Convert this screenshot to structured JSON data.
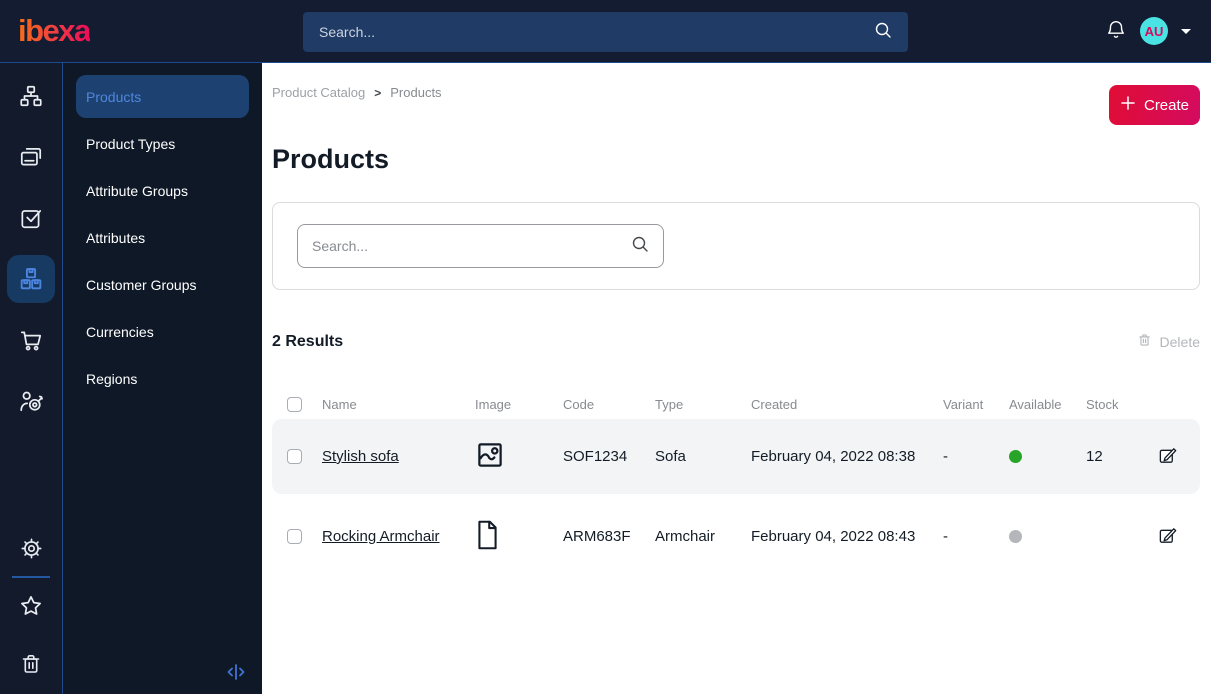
{
  "topbar": {
    "logo_text": "ibexa",
    "search_placeholder": "Search...",
    "avatar_initials": "AU",
    "icons": [
      "search-icon",
      "bell-icon",
      "caret-down-icon"
    ]
  },
  "rail": {
    "items": [
      {
        "icon": "content-tree-icon",
        "active": false
      },
      {
        "icon": "pages-icon",
        "active": false
      },
      {
        "icon": "tasks-icon",
        "active": false
      },
      {
        "icon": "product-catalog-icon",
        "active": true
      },
      {
        "icon": "commerce-cart-icon",
        "active": false
      },
      {
        "icon": "personalization-target-icon",
        "active": false
      }
    ],
    "bottom_items": [
      {
        "icon": "settings-gear-icon"
      },
      {
        "icon": "favorites-star-icon"
      },
      {
        "icon": "trash-icon"
      }
    ]
  },
  "sidebar": {
    "items": [
      {
        "label": "Products",
        "active": true
      },
      {
        "label": "Product Types",
        "active": false
      },
      {
        "label": "Attribute Groups",
        "active": false
      },
      {
        "label": "Attributes",
        "active": false
      },
      {
        "label": "Customer Groups",
        "active": false
      },
      {
        "label": "Currencies",
        "active": false
      },
      {
        "label": "Regions",
        "active": false
      }
    ],
    "collapse_icon": "collapse-panel-icon"
  },
  "breadcrumb": {
    "items": [
      "Product Catalog",
      "Products"
    ],
    "separator": ">"
  },
  "page": {
    "title": "Products",
    "create_label": "Create"
  },
  "filters": {
    "search_placeholder": "Search..."
  },
  "results": {
    "count_label": "2 Results",
    "delete_label": "Delete"
  },
  "table": {
    "headers": [
      "Name",
      "Image",
      "Code",
      "Type",
      "Created",
      "Variant",
      "Available",
      "Stock"
    ],
    "rows": [
      {
        "name": "Stylish sofa",
        "image_icon": "photo-icon",
        "code": "SOF1234",
        "type": "Sofa",
        "created": "February 04, 2022 08:38",
        "variant": "-",
        "available": true,
        "available_class": "dot available",
        "stock": "12"
      },
      {
        "name": "Rocking Armchair",
        "image_icon": "file-icon",
        "code": "ARM683F",
        "type": "Armchair",
        "created": "February 04, 2022 08:43",
        "variant": "-",
        "available": false,
        "available_class": "dot unavailable",
        "stock": ""
      }
    ]
  },
  "colors": {
    "topbar_bg": "#131c30",
    "accent_red": "#e00d35",
    "accent_pink": "#d40b60",
    "active_blue": "#4c85e0",
    "available_green": "#28a428",
    "unavailable_gray": "#b4b6b9",
    "avatar_bg": "#49e3e3",
    "avatar_text": "#d6095c"
  }
}
